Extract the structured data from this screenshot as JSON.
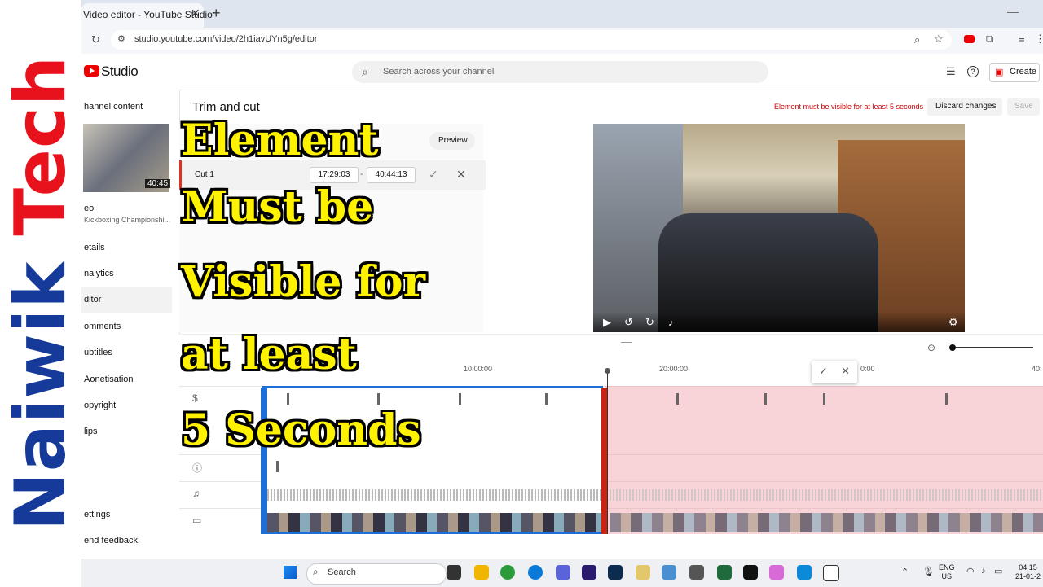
{
  "browser": {
    "tab_title": "Video editor - YouTube Studio",
    "url": "studio.youtube.com/video/2h1iavUYn5g/editor"
  },
  "studio": {
    "logo_text": "Studio",
    "search_placeholder": "Search across your channel",
    "create_label": "Create"
  },
  "sidebar": {
    "channel_content": "hannel content",
    "video_duration": "40:45",
    "video_title": "eo",
    "video_subtitle": "Kickboxing Championshi...",
    "items": [
      {
        "label": "etails"
      },
      {
        "label": "nalytics"
      },
      {
        "label": "ditor"
      },
      {
        "label": "omments"
      },
      {
        "label": "ubtitles"
      },
      {
        "label": "Aonetisation"
      },
      {
        "label": "opyright"
      },
      {
        "label": "lips"
      },
      {
        "label": "ettings"
      },
      {
        "label": "end feedback"
      }
    ]
  },
  "editor": {
    "heading": "Trim and cut",
    "warning": "Element must be visible for at least 5 seconds",
    "discard_label": "Discard changes",
    "save_label": "Save",
    "preview_label": "Preview",
    "cut_label": "Cut 1",
    "cut_start": "17:29:03",
    "cut_end": "40:44:13",
    "cut_dash": "-"
  },
  "timeline": {
    "ticks": [
      "10:00:00",
      "20:00:00",
      "0:00",
      "40:"
    ]
  },
  "overlay": {
    "brand_part1": "Naiwik ",
    "brand_part2": "Tech",
    "caption_lines": [
      "Element",
      "Must be",
      "Visible for",
      "at least",
      "5 Seconds"
    ]
  },
  "taskbar": {
    "search_label": "Search",
    "lang_top": "ENG",
    "lang_bottom": "US",
    "time": "04:15",
    "date": "21-01-2"
  },
  "colors": {
    "brand_red": "#e8121c",
    "brand_blue": "#163a9a",
    "caption_yellow": "#fff200",
    "warning_red": "#cc0000",
    "kept_border_blue": "#1e6ed8",
    "cut_region_pink": "#f5c2c8"
  }
}
